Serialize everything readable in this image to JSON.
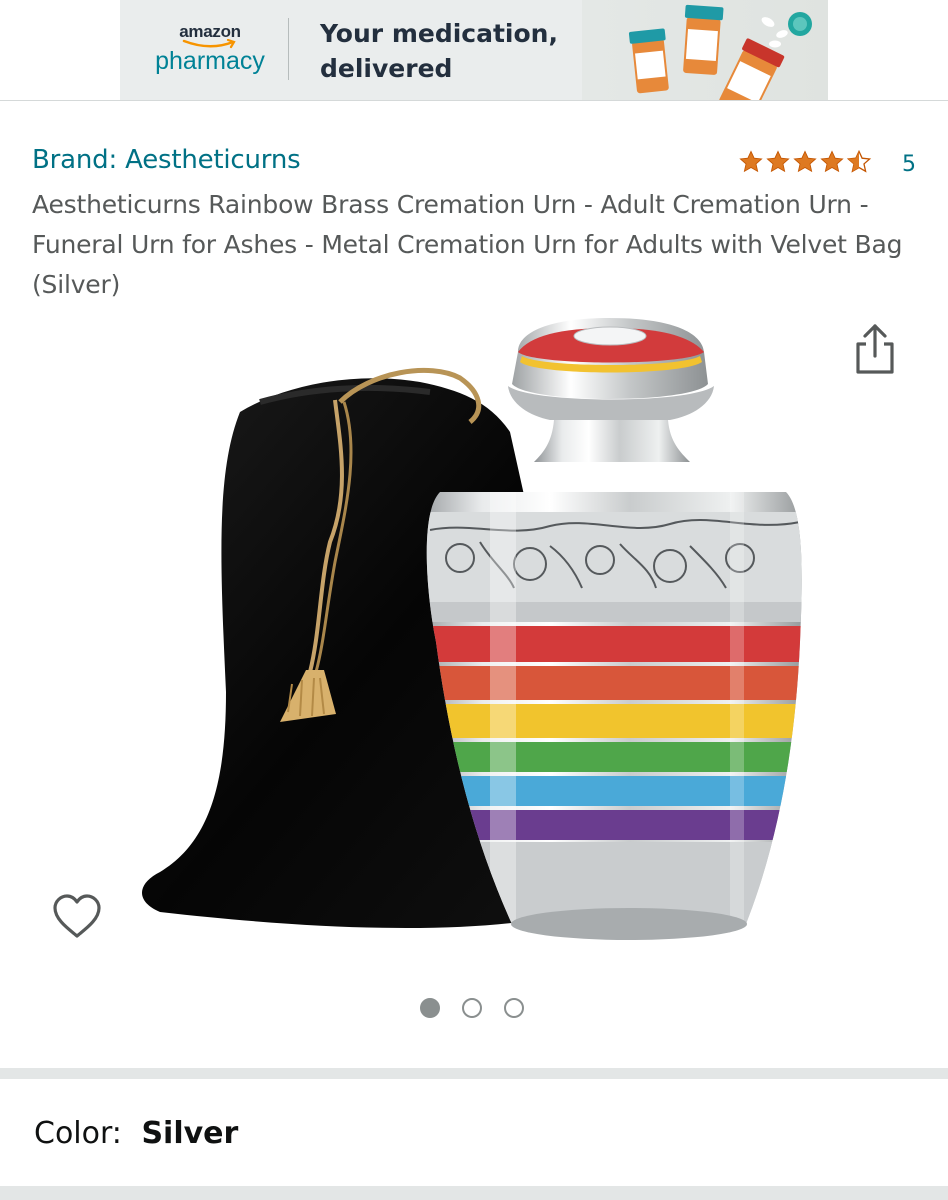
{
  "banner": {
    "logo_top": "amazon",
    "logo_bottom": "pharmacy",
    "line1": "Your medication,",
    "line2": "delivered",
    "bg_color": "#eaeded",
    "accent_color": "#008296"
  },
  "product": {
    "brand": "Brand: Aestheticurns",
    "rating_stars": 4.5,
    "rating_count": "5",
    "title": "Aestheticurns Rainbow Brass Cremation Urn - Adult Cremation Urn - Funeral Urn for Ashes - Metal Cremation Urn for Adults with Velvet Bag (Silver)",
    "link_color": "#007185",
    "star_color": "#de7921"
  },
  "gallery": {
    "image_count": 3,
    "active_index": 0,
    "share_icon": "share-icon",
    "wishlist_icon": "heart-icon"
  },
  "variation": {
    "label": "Color:",
    "value": "Silver"
  }
}
